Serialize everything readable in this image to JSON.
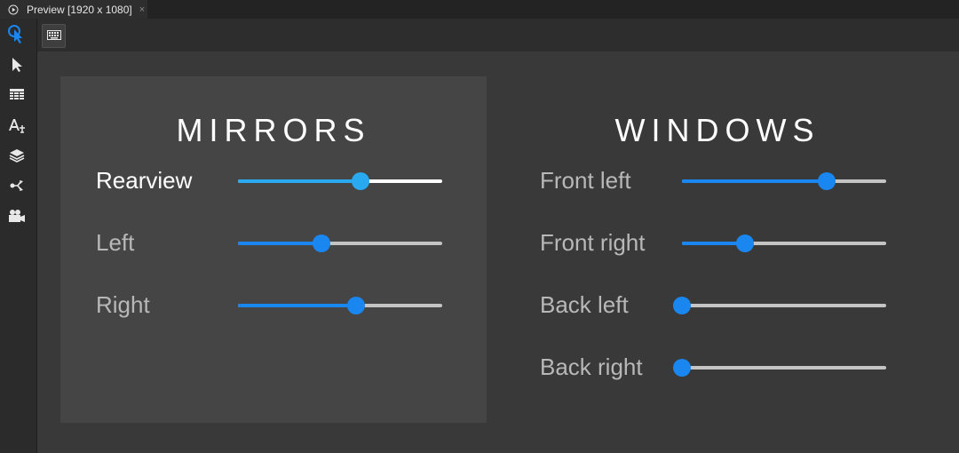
{
  "tab": {
    "title": "Preview [1920 x 1080]",
    "close": "×"
  },
  "tools": [
    "pointer-touch-icon",
    "select-arrow-icon",
    "grid-icon",
    "text-style-icon",
    "layers-icon",
    "connection-icon",
    "camera-icon"
  ],
  "colors": {
    "accent": "#1a86f0",
    "focused_accent": "#29aaf0",
    "track": "#c4c4c4"
  },
  "mirrors": {
    "title": "MIRRORS",
    "sliders": [
      {
        "label": "Rearview",
        "value": 0.6,
        "focused": true
      },
      {
        "label": "Left",
        "value": 0.41,
        "focused": false
      },
      {
        "label": "Right",
        "value": 0.58,
        "focused": false
      }
    ]
  },
  "windows": {
    "title": "WINDOWS",
    "sliders": [
      {
        "label": "Front left",
        "value": 0.71
      },
      {
        "label": "Front right",
        "value": 0.31
      },
      {
        "label": "Back left",
        "value": 0.0
      },
      {
        "label": "Back right",
        "value": 0.0
      }
    ]
  }
}
